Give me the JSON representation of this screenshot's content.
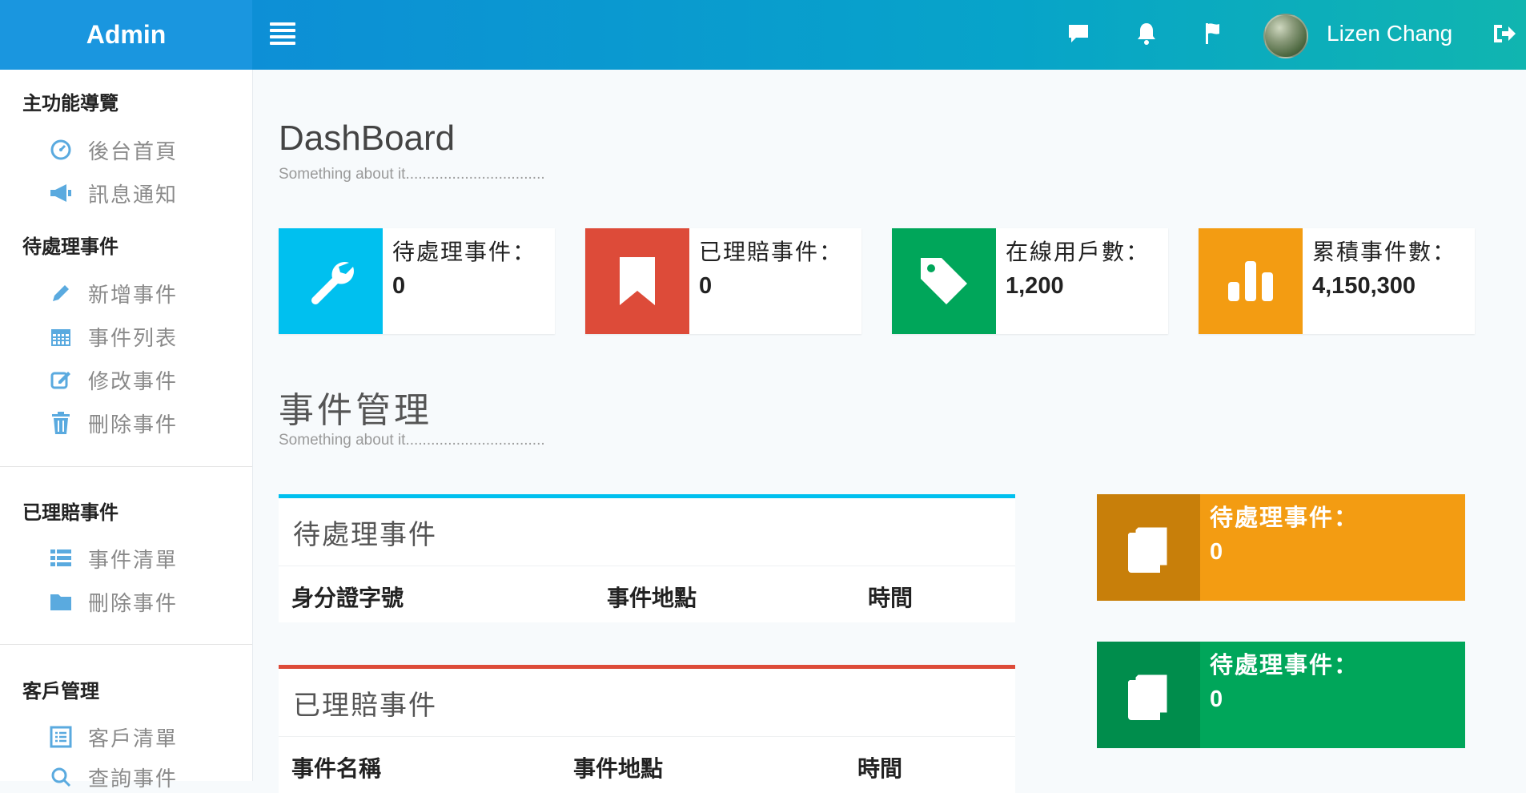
{
  "brand": "Admin",
  "user": {
    "name": "Lizen Chang"
  },
  "nav_icons": [
    "chat-icon",
    "bell-icon",
    "flag-icon",
    "logout-icon"
  ],
  "sidebar": {
    "sections": [
      {
        "title": "主功能導覽",
        "items": [
          {
            "label": "後台首頁",
            "icon": "dashboard-icon"
          },
          {
            "label": "訊息通知",
            "icon": "megaphone-icon"
          }
        ]
      },
      {
        "title": "待處理事件",
        "items": [
          {
            "label": "新增事件",
            "icon": "pencil-icon"
          },
          {
            "label": "事件列表",
            "icon": "calendar-icon"
          },
          {
            "label": "修改事件",
            "icon": "edit-icon"
          },
          {
            "label": "刪除事件",
            "icon": "trash-icon"
          }
        ]
      },
      {
        "title": "已理賠事件",
        "items": [
          {
            "label": "事件清單",
            "icon": "list-icon"
          },
          {
            "label": "刪除事件",
            "icon": "folder-icon"
          }
        ]
      },
      {
        "title": "客戶管理",
        "items": [
          {
            "label": "客戶清單",
            "icon": "list-alt-icon"
          },
          {
            "label": "查詢事件",
            "icon": "search-icon"
          }
        ]
      }
    ]
  },
  "dashboard": {
    "title": "DashBoard",
    "subtitle": "Something about it................................."
  },
  "stats": [
    {
      "label": "待處理事件：",
      "value": "0",
      "color": "#00c0ef",
      "icon": "wrench-icon"
    },
    {
      "label": "已理賠事件：",
      "value": "0",
      "color": "#dd4b39",
      "icon": "bookmark-icon"
    },
    {
      "label": "在線用戶數：",
      "value": "1,200",
      "color": "#00a65a",
      "icon": "tag-icon"
    },
    {
      "label": "累積事件數：",
      "value": "4,150,300",
      "color": "#f39c12",
      "icon": "bar-chart-icon"
    }
  ],
  "events": {
    "title": "事件管理",
    "subtitle": "Something about it................................."
  },
  "panels": [
    {
      "title": "待處理事件",
      "color": "#00c0ef",
      "columns": [
        "身分證字號",
        "事件地點",
        "時間"
      ]
    },
    {
      "title": "已理賠事件",
      "color": "#dd4b39",
      "columns": [
        "事件名稱",
        "事件地點",
        "時間"
      ]
    }
  ],
  "mini_boxes": [
    {
      "label": "待處理事件：",
      "value": "0",
      "color": "#f39c12",
      "dark": "#c87f0a",
      "icon": "book-icon"
    },
    {
      "label": "待處理事件：",
      "value": "0",
      "color": "#00a65a",
      "dark": "#008d4c",
      "icon": "book-icon"
    }
  ]
}
